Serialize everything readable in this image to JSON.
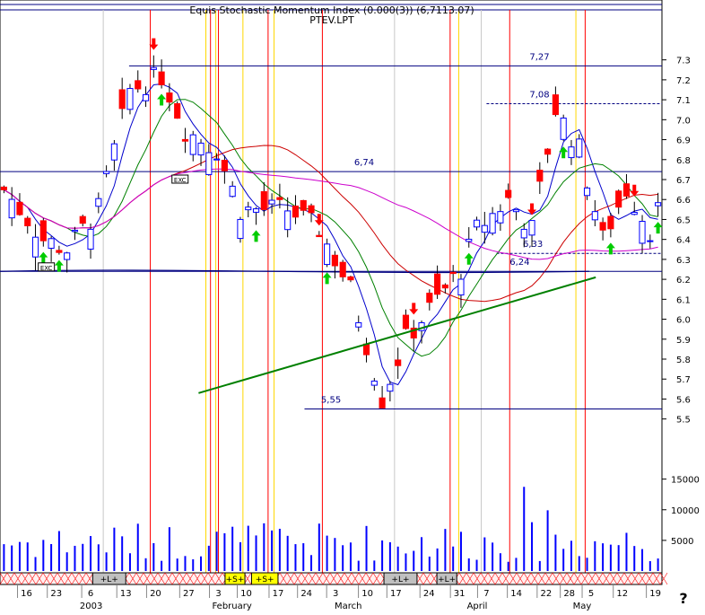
{
  "header": {
    "title_line1": "Equis  Stochastic Momentum Index (0.000(3)) (6,7113.07)",
    "title_line2": "PTEV.LPT"
  },
  "colors": {
    "up": "#0000ff",
    "down": "#ff0000",
    "ma_fast": "#0000cc",
    "ma_green": "#008000",
    "ma_red": "#cc0000",
    "ma_magenta": "#cc00cc",
    "ma_navy": "#000080",
    "trend": "#008000",
    "level": "#000080",
    "vline_red": "#ff0000",
    "vline_yellow": "#ffd700",
    "vline_gray": "#c8c8c8",
    "volume": "#0000ff",
    "arrow_up": "#00cc00",
    "arrow_down": "#ff0000",
    "band_red": "#ff0000",
    "band_yellow": "#ffff00",
    "band_gray": "#c0c0c0"
  },
  "icons": {
    "help": "question-mark-icon"
  },
  "help_label": "?",
  "chart_data": {
    "type": "candlestick",
    "title": "PTEV.LPT",
    "price_axis": {
      "ylim": [
        5.44,
        7.42
      ],
      "ticks": [
        "7.3",
        "7.2",
        "7.1",
        "7.0",
        "6.9",
        "6.8",
        "6.7",
        "6.6",
        "6.5",
        "6.4",
        "6.3",
        "6.2",
        "6.1",
        "6.0",
        "5.9",
        "5.8",
        "5.7",
        "5.6",
        "5.5"
      ]
    },
    "volume_axis": {
      "ylim": [
        0,
        17000
      ],
      "ticks": [
        "15000",
        "10000",
        "5000"
      ]
    },
    "x_axis": {
      "day_labels": [
        "16",
        "23",
        "6",
        "13",
        "20",
        "27",
        "3",
        "10",
        "17",
        "24",
        "3",
        "10",
        "17",
        "24",
        "31",
        "7",
        "14",
        "22",
        "28",
        "5",
        "12",
        "19"
      ],
      "month_labels": [
        "2003",
        "February",
        "March",
        "April",
        "May"
      ]
    },
    "price_levels": [
      {
        "label": "7,27",
        "value": 7.27,
        "style": "solid"
      },
      {
        "label": "7,08",
        "value": 7.08,
        "style": "dashed"
      },
      {
        "label": "6,74",
        "value": 6.74,
        "style": "solid"
      },
      {
        "label": "6,33",
        "value": 6.33,
        "style": "dashed"
      },
      {
        "label": "6,24",
        "value": 6.24,
        "style": "solid"
      },
      {
        "label": "5,55",
        "value": 5.55,
        "style": "solid"
      }
    ],
    "trendline": {
      "from": [
        0.3,
        5.63
      ],
      "to": [
        0.9,
        6.21
      ]
    },
    "annotations": [
      "EXC",
      "EXC"
    ],
    "bands": [
      {
        "from": 0.14,
        "to": 0.19,
        "label": "+L+"
      },
      {
        "from": 0.34,
        "to": 0.37,
        "label": "+S+"
      },
      {
        "from": 0.38,
        "to": 0.42,
        "label": "+S+"
      },
      {
        "from": 0.58,
        "to": 0.63,
        "label": "+L+"
      },
      {
        "from": 0.66,
        "to": 0.69,
        "label": "+L+"
      }
    ]
  }
}
